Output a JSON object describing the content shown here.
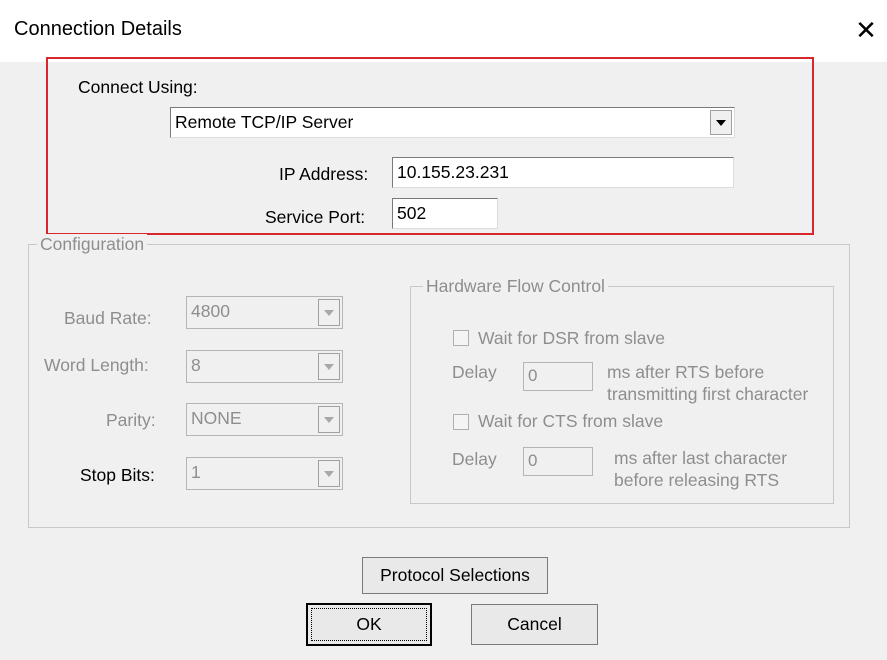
{
  "window": {
    "title": "Connection Details",
    "close_glyph": "✕"
  },
  "connection": {
    "connect_using_label": "Connect Using:",
    "connect_using_value": "Remote TCP/IP Server",
    "ip_label": "IP Address:",
    "ip_value": "10.155.23.231",
    "port_label": "Service Port:",
    "port_value": "502",
    "highlight_color": "#d9262c"
  },
  "configuration": {
    "legend": "Configuration",
    "baud_rate_label": "Baud Rate:",
    "baud_rate_value": "4800",
    "word_length_label": "Word Length:",
    "word_length_value": "8",
    "parity_label": "Parity:",
    "parity_value": "NONE",
    "stop_bits_label": "Stop Bits:",
    "stop_bits_value": "1"
  },
  "flow_control": {
    "legend": "Hardware Flow Control",
    "dsr_label": "Wait for DSR from slave",
    "dsr_delay_label": "Delay",
    "dsr_delay_value": "0",
    "dsr_note_1": "ms after RTS before",
    "dsr_note_2": "transmitting first character",
    "cts_label": "Wait for CTS from slave",
    "cts_delay_label": "Delay",
    "cts_delay_value": "0",
    "cts_note_1": "ms after last character",
    "cts_note_2": "before releasing RTS"
  },
  "buttons": {
    "protocol": "Protocol Selections",
    "ok": "OK",
    "cancel": "Cancel"
  }
}
